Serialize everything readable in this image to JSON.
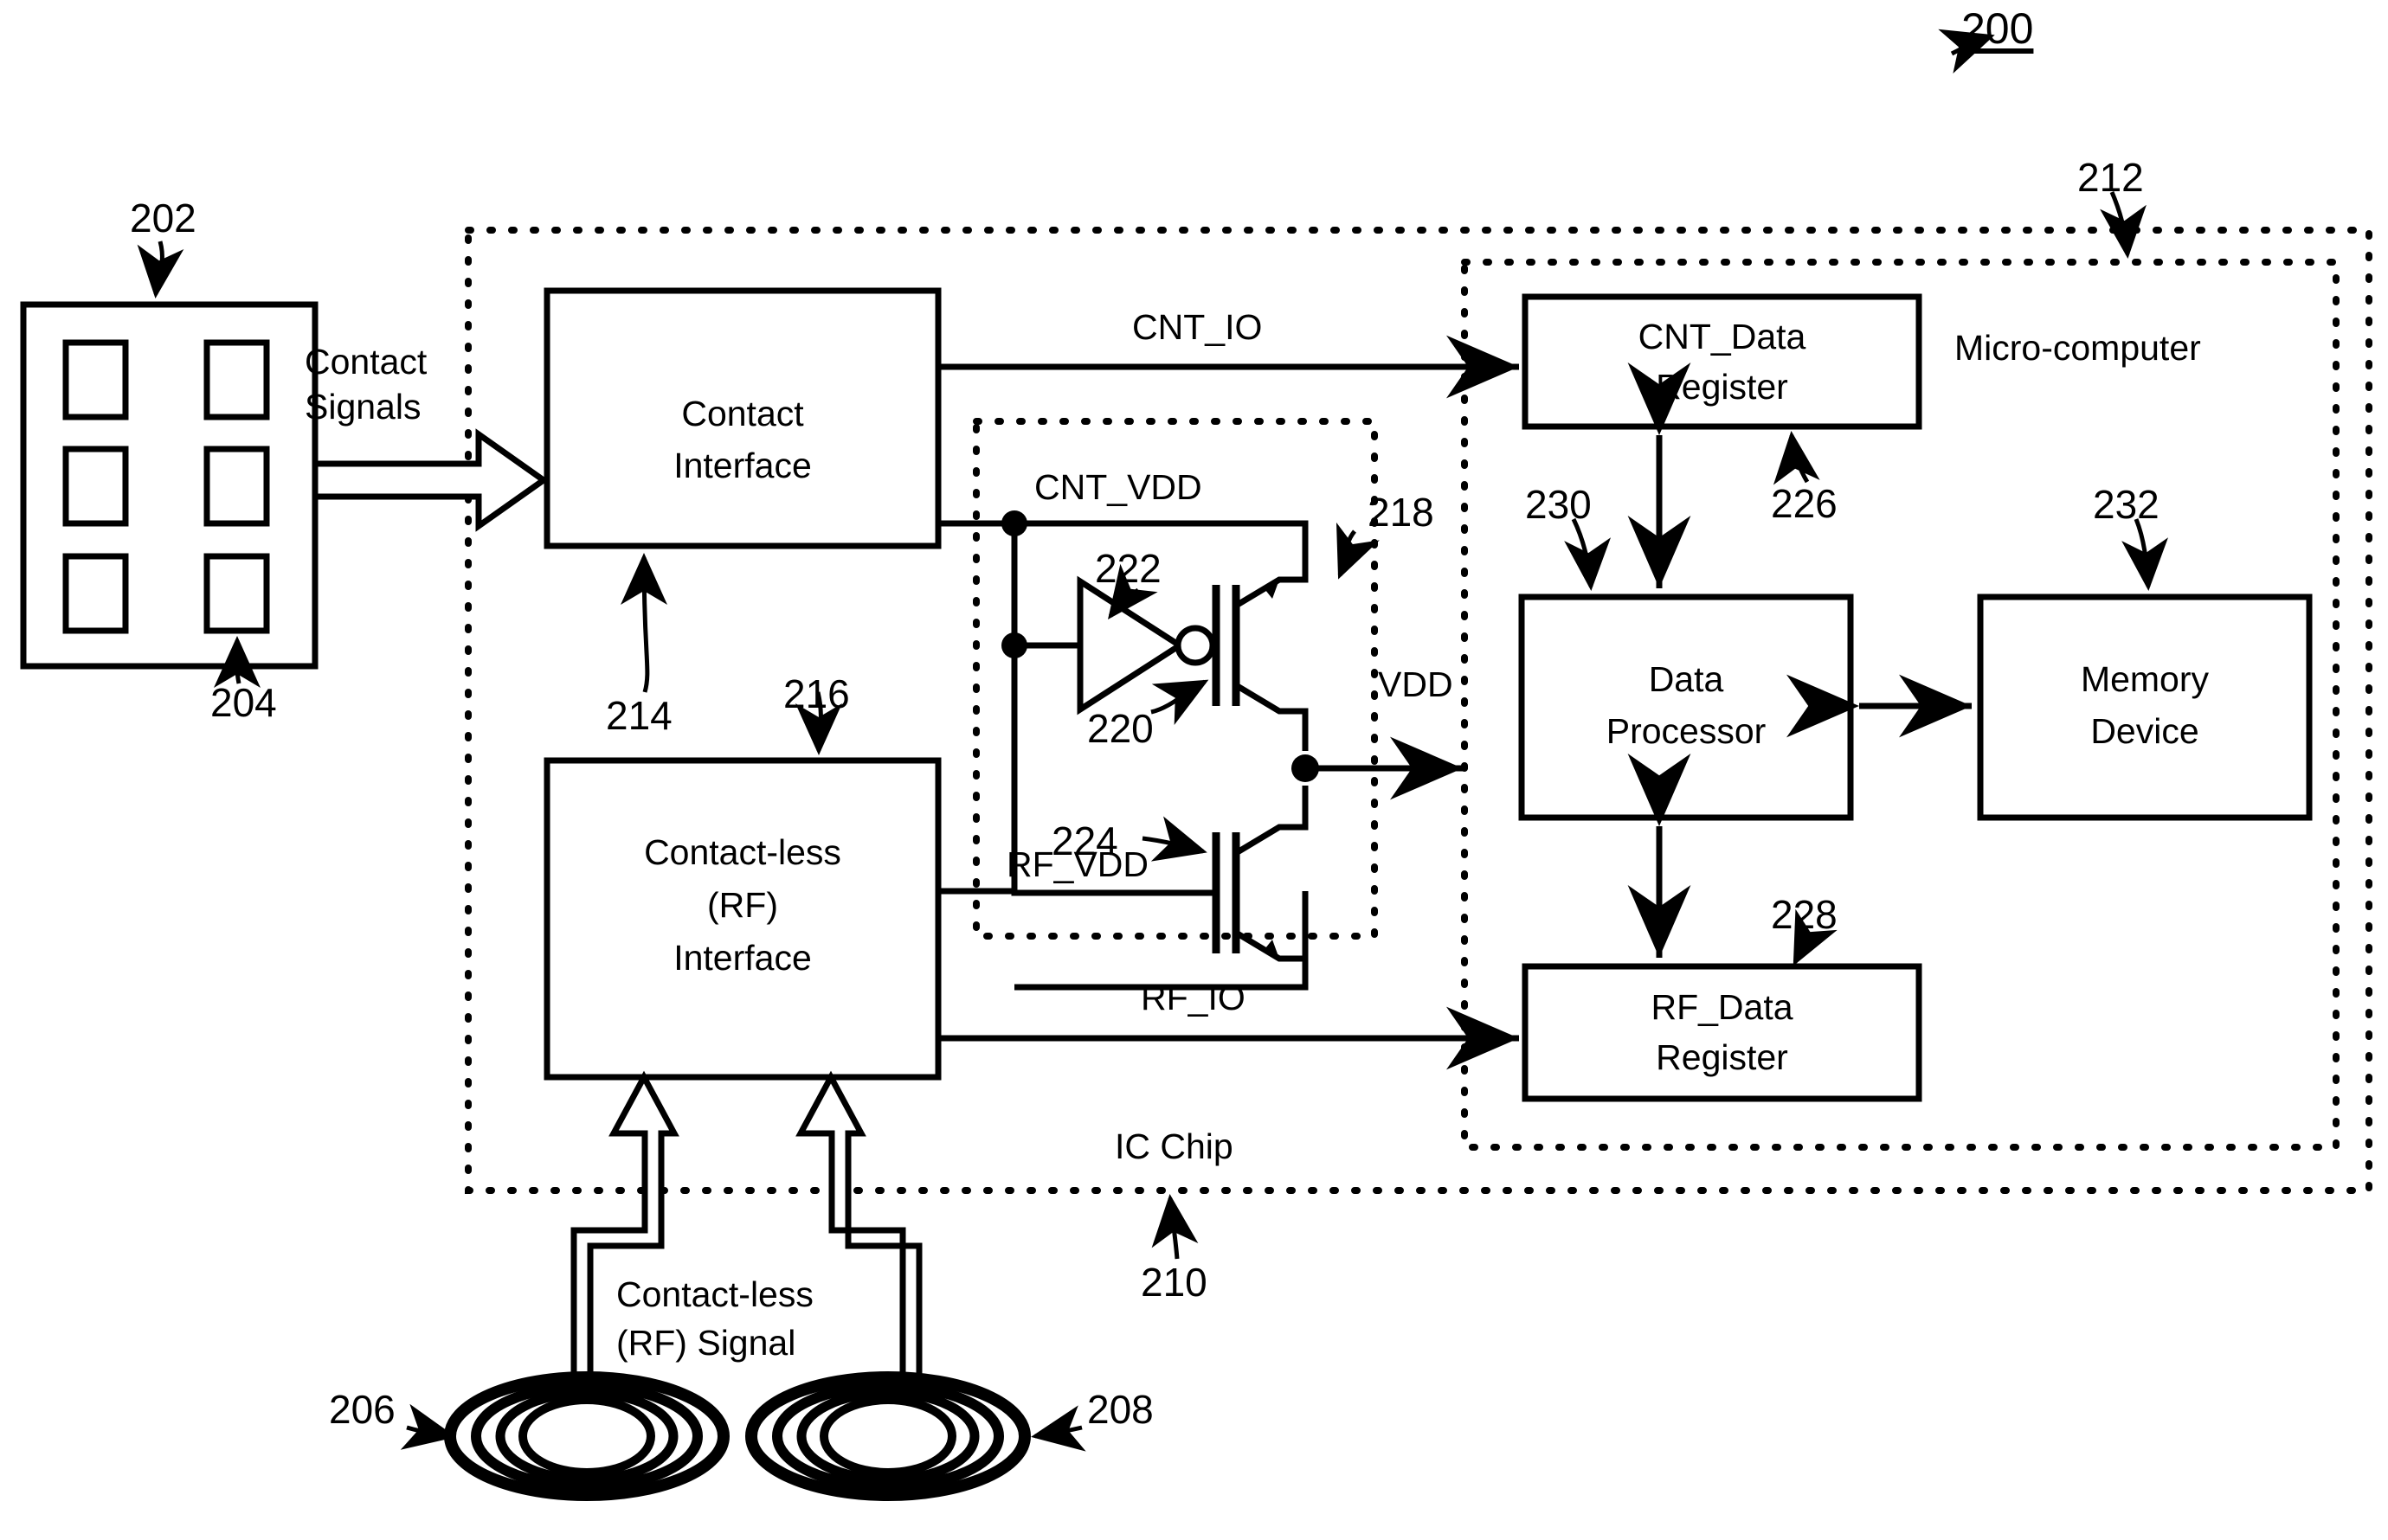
{
  "figure": {
    "id": "200",
    "id_underlined": true
  },
  "reference_numerals": {
    "card": "202",
    "contact_pad": "204",
    "antenna_left": "206",
    "antenna_right": "208",
    "ic_chip": "210",
    "micro_computer": "212",
    "contact_interface": "214",
    "contactless_interface": "216",
    "power_select_circuit": "218",
    "transistor_top": "220",
    "inverter": "222",
    "transistor_bottom": "224",
    "cnt_data_register": "226",
    "rf_data_register": "228",
    "data_processor": "230",
    "memory_device": "232"
  },
  "blocks": {
    "contact_interface": {
      "lines": [
        "Contact",
        "Interface"
      ]
    },
    "contactless_interface": {
      "lines": [
        "Contact-less",
        "(RF)",
        "Interface"
      ]
    },
    "cnt_data_register": {
      "lines": [
        "CNT_Data",
        "Register"
      ]
    },
    "rf_data_register": {
      "lines": [
        "RF_Data",
        "Register"
      ]
    },
    "data_processor": {
      "lines": [
        "Data",
        "Processor"
      ]
    },
    "memory_device": {
      "lines": [
        "Memory",
        "Device"
      ]
    }
  },
  "region_labels": {
    "ic_chip": "IC Chip",
    "micro_computer": "Micro-computer"
  },
  "signal_labels": {
    "contact_signals": [
      "Contact",
      "Signals"
    ],
    "cnt_io": "CNT_IO",
    "rf_io": "RF_IO",
    "cnt_vdd": "CNT_VDD",
    "rf_vdd": "RF_VDD",
    "vdd": "VDD",
    "contactless_signal": [
      "Contact-less",
      "(RF) Signal"
    ]
  },
  "colors": {
    "ink": "#000000",
    "paper": "#ffffff"
  }
}
